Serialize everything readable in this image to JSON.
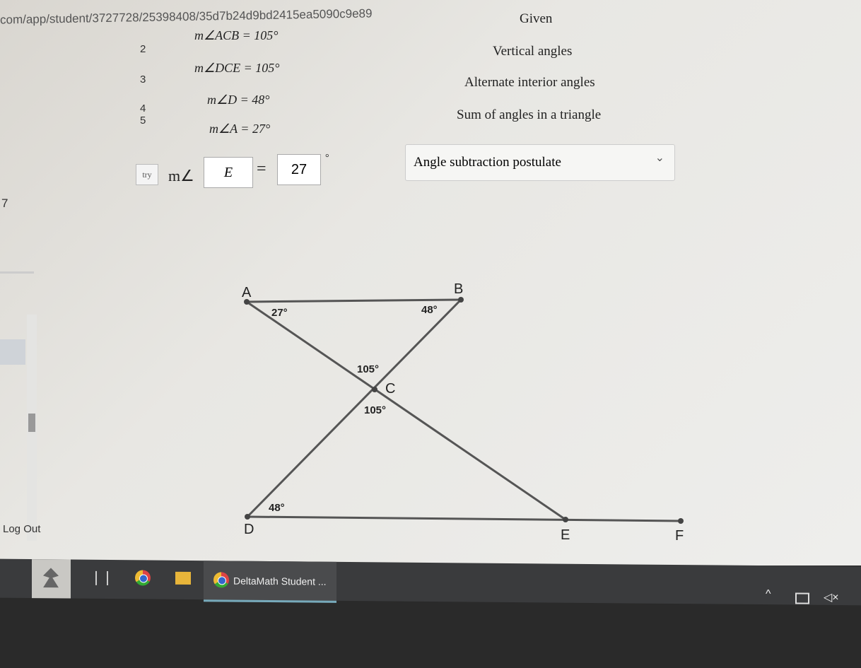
{
  "browser": {
    "url": "com/app/student/3727728/25398408/35d7b24d9bd2415ea5090c9e89"
  },
  "proof": {
    "rows": [
      {
        "num": "2",
        "statement": "m∠ACB = 105°",
        "reason": "Given"
      },
      {
        "num": "3",
        "statement": "m∠DCE = 105°",
        "reason": "Vertical angles"
      },
      {
        "num": "4",
        "statement": "m∠D = 48°",
        "reason": "Alternate interior angles"
      },
      {
        "num": "5",
        "statement": "m∠A = 27°",
        "reason": "Sum of angles in a triangle"
      }
    ],
    "try_label": "try",
    "current": {
      "prefix": "m∠",
      "angle_value": "E",
      "equals": "=",
      "measure_value": "27",
      "degree": "°",
      "reason_selected": "Angle subtraction postulate"
    },
    "next_num": "7"
  },
  "sidebar": {
    "logout": "Log Out"
  },
  "diagram": {
    "points": {
      "A": "A",
      "B": "B",
      "C": "C",
      "D": "D",
      "E": "E",
      "F": "F"
    },
    "angles": {
      "A": "27°",
      "B": "48°",
      "ACB": "105°",
      "DCE": "105°",
      "D": "48°"
    }
  },
  "taskbar": {
    "active_window": "DeltaMath Student ..."
  }
}
